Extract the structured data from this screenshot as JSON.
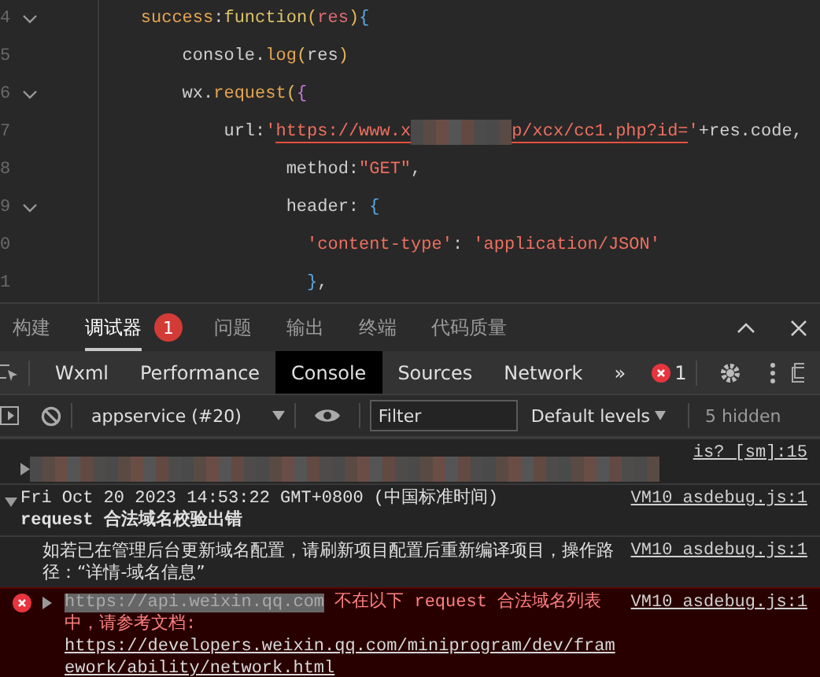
{
  "editor": {
    "lines": [
      {
        "number": "4",
        "foldable": true,
        "tokens": [
          {
            "kind": "prop",
            "text": "    success"
          },
          {
            "kind": "plain",
            "text": ":"
          },
          {
            "kind": "kw",
            "text": "function"
          },
          {
            "kind": "paren",
            "text": "("
          },
          {
            "kind": "var",
            "text": "res"
          },
          {
            "kind": "paren",
            "text": ")"
          },
          {
            "kind": "brace",
            "text": "{"
          }
        ]
      },
      {
        "number": "5",
        "foldable": false,
        "tokens": [
          {
            "kind": "plain",
            "text": "        console."
          },
          {
            "kind": "prop",
            "text": "log"
          },
          {
            "kind": "paren",
            "text": "("
          },
          {
            "kind": "plain",
            "text": "res"
          },
          {
            "kind": "paren",
            "text": ")"
          }
        ]
      },
      {
        "number": "6",
        "foldable": true,
        "tokens": [
          {
            "kind": "plain",
            "text": "        wx."
          },
          {
            "kind": "prop",
            "text": "request"
          },
          {
            "kind": "paren",
            "text": "("
          },
          {
            "kind": "bracket",
            "text": "{"
          }
        ]
      },
      {
        "number": "7",
        "foldable": false,
        "tokens": [
          {
            "kind": "plain",
            "text": "            url:"
          },
          {
            "kind": "str",
            "text": "'"
          },
          {
            "kind": "link",
            "text": "https://www.x"
          },
          {
            "kind": "redacted"
          },
          {
            "kind": "link",
            "text": "p/xcx/cc1.php?id="
          },
          {
            "kind": "str",
            "text": "'"
          },
          {
            "kind": "plain",
            "text": "+res.code,"
          }
        ]
      },
      {
        "number": "8",
        "foldable": false,
        "tokens": [
          {
            "kind": "plain",
            "text": "                  method:"
          },
          {
            "kind": "str",
            "text": "\"GET\""
          },
          {
            "kind": "plain",
            "text": ","
          }
        ]
      },
      {
        "number": "9",
        "foldable": true,
        "tokens": [
          {
            "kind": "plain",
            "text": "                  header: "
          },
          {
            "kind": "brace",
            "text": "{"
          }
        ]
      },
      {
        "number": "0",
        "foldable": false,
        "tokens": [
          {
            "kind": "str",
            "text": "                    'content-type'"
          },
          {
            "kind": "plain",
            "text": ": "
          },
          {
            "kind": "str",
            "text": "'application/JSON'"
          }
        ]
      },
      {
        "number": "1",
        "foldable": false,
        "tokens": [
          {
            "kind": "brace",
            "text": "                    }"
          },
          {
            "kind": "plain",
            "text": ","
          }
        ]
      }
    ]
  },
  "panel_tabs": [
    {
      "label": "构建",
      "selected": false
    },
    {
      "label": "调试器",
      "selected": true,
      "badge": "1"
    },
    {
      "label": "问题",
      "selected": false
    },
    {
      "label": "输出",
      "selected": false
    },
    {
      "label": "终端",
      "selected": false
    },
    {
      "label": "代码质量",
      "selected": false
    }
  ],
  "devtools_tabs": [
    {
      "label": "Wxml",
      "selected": false
    },
    {
      "label": "Performance",
      "selected": false
    },
    {
      "label": "Console",
      "selected": true
    },
    {
      "label": "Sources",
      "selected": false
    },
    {
      "label": "Network",
      "selected": false
    }
  ],
  "more_tabs": "»",
  "error_count": "1",
  "console_toolbar": {
    "context": "appservice (#20)",
    "filter_placeholder": "Filter",
    "levels": "Default levels",
    "hidden": "5 hidden"
  },
  "messages": [
    {
      "kind": "redacted",
      "source": "is? [sm]:15"
    },
    {
      "kind": "group",
      "expanded": true,
      "text": "Fri Oct 20 2023 14:53:22 GMT+0800 (中国标准时间)",
      "subtitle": "request 合法域名校验出错",
      "source": "VM10 asdebug.js:1"
    },
    {
      "kind": "info",
      "text": "如若已在管理后台更新域名配置，请刷新项目配置后重新编译项目，操作路径：“详情-域名信息”",
      "source": "VM10 asdebug.js:1"
    },
    {
      "kind": "error",
      "highlight": "https://api.weixin.qq.com",
      "text": " 不在以下 request 合法域名列表中，请参考文档: ",
      "link": "https://developers.weixin.qq.com/miniprogram/dev/framework/ability/network.html",
      "source": "VM10 asdebug.js:1"
    }
  ]
}
